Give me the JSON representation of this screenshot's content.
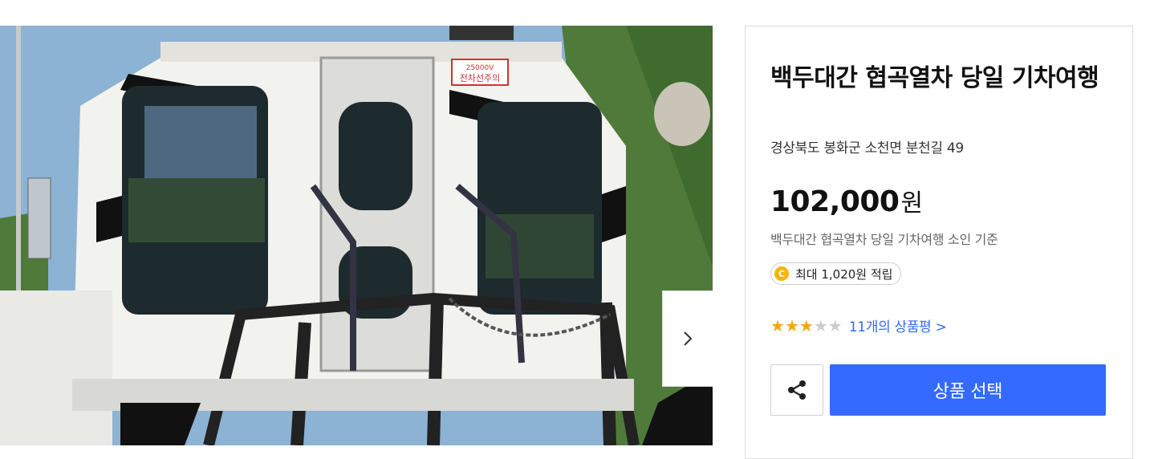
{
  "gallery": {
    "image_alt": "train-photo",
    "plate_text": "25000V\n전차선주의",
    "next_icon": "chevron-right-icon"
  },
  "product": {
    "title": "백두대간 협곡열차 당일 기차여행",
    "address": "경상북도 봉화군 소천면 분천길 49",
    "price_value": "102,000",
    "price_unit": "원",
    "price_note": "백두대간 협곡열차 당일 기차여행 소인 기준",
    "points_icon": "C",
    "points_text": "최대 1,020원 적립",
    "rating": {
      "filled": 3,
      "total": 5
    },
    "review_count": "11개",
    "review_suffix": "의 상품평 >"
  },
  "actions": {
    "share_icon": "share-icon",
    "select_label": "상품 선택"
  },
  "colors": {
    "accent": "#346aff",
    "star": "#f4a70a",
    "coin": "#f6b40e"
  }
}
